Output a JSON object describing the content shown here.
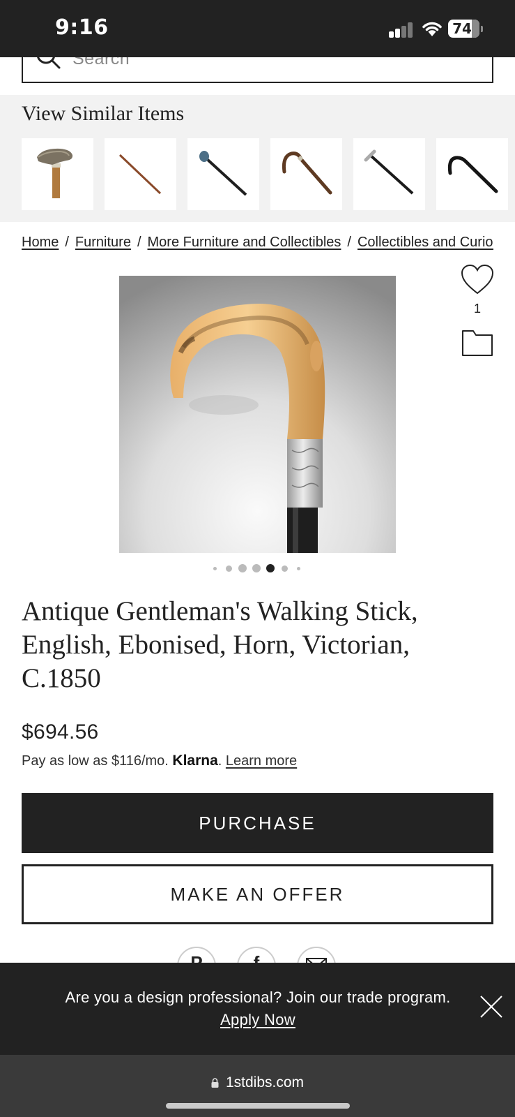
{
  "status_bar": {
    "time": "9:16",
    "battery": "74"
  },
  "search": {
    "placeholder": "Search"
  },
  "similar": {
    "title": "View Similar Items",
    "items": [
      "horse-head-cane",
      "wooden-cane",
      "blue-knob-cane",
      "crook-cane",
      "silver-handle-cane",
      "black-crook-cane"
    ]
  },
  "breadcrumb": [
    "Home",
    "Furniture",
    "More Furniture and Collectibles",
    "Collectibles and Curiosities"
  ],
  "product": {
    "favorites": "1",
    "title": "Antique Gentleman's Walking Stick, English, Ebonised, Horn, Victorian, C.1850",
    "price": "$694.56",
    "klarna_prefix": "Pay as low as $116/mo.",
    "klarna_brand": "Klarna",
    "klarna_link": "Learn more",
    "image_count": 7,
    "active_image_index": 4
  },
  "buttons": {
    "purchase": "PURCHASE",
    "offer": "MAKE AN OFFER"
  },
  "share": [
    "pinterest-icon",
    "facebook-icon",
    "email-icon"
  ],
  "trade_banner": {
    "text": "Are you a design professional? Join our trade program.",
    "link": "Apply Now"
  },
  "browser": {
    "url": "1stdibs.com"
  }
}
